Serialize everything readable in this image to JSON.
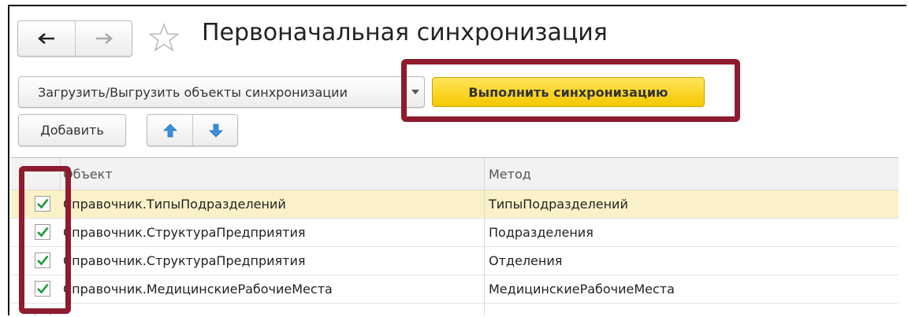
{
  "window": {
    "title": "Первоначальная синхронизация",
    "back_icon": "arrow-left-icon",
    "forward_icon": "arrow-right-icon",
    "favorite_icon": "star-icon"
  },
  "toolbar": {
    "load_unload_label": "Загрузить/Выгрузить объекты синхронизации",
    "run_sync_label": "Выполнить синхронизацию",
    "add_label": "Добавить",
    "up_icon": "arrow-up-icon",
    "down_icon": "arrow-down-icon"
  },
  "table": {
    "columns": [
      "Объект",
      "Метод"
    ],
    "rows": [
      {
        "checked": true,
        "object": "Справочник.ТипыПодразделений",
        "method": "ТипыПодразделений"
      },
      {
        "checked": true,
        "object": "Справочник.СтруктураПредприятия",
        "method": "Подразделения"
      },
      {
        "checked": true,
        "object": "Справочник.СтруктураПредприятия",
        "method": "Отделения"
      },
      {
        "checked": true,
        "object": "Справочник.МедицинскиеРабочиеМеста",
        "method": "МедицинскиеРабочиеМеста"
      }
    ]
  },
  "colors": {
    "highlight_frame": "#8e1b2e",
    "run_button": "#f5c800",
    "selected_row": "#fbf1c8",
    "checkbox_mark": "#1a9a3a"
  }
}
